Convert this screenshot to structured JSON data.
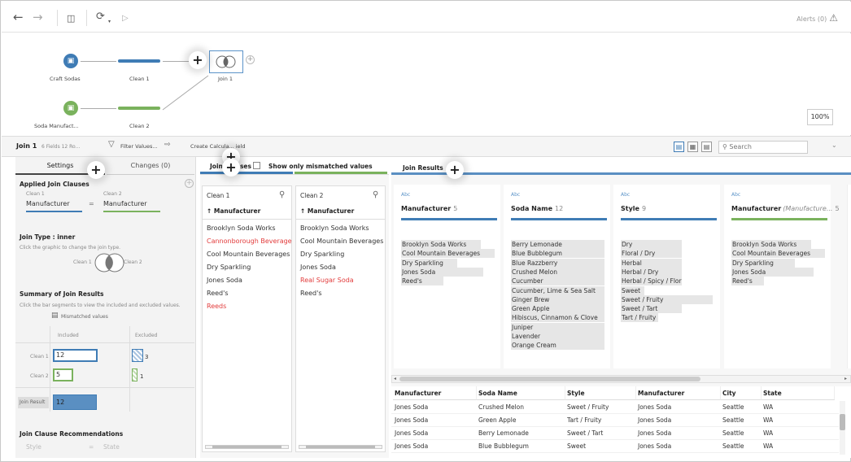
{
  "toolbar": {
    "alerts_label": "Alerts (0)"
  },
  "flow": {
    "nodes": [
      {
        "label": "Craft Sodas"
      },
      {
        "label": "Clean 1"
      },
      {
        "label": "Join 1"
      },
      {
        "label": "Soda Manufact..."
      },
      {
        "label": "Clean 2"
      }
    ],
    "zoom": "100%"
  },
  "step_bar": {
    "name": "Join 1",
    "meta": "6 Fields  12 Ro...",
    "filter_label": "Filter Values...",
    "calc_label": "Create Calcula...  ield",
    "search_placeholder": "Search"
  },
  "left_panel": {
    "tabs": [
      "Settings",
      "Changes (0)"
    ],
    "applied_title": "Applied Join Clauses",
    "clause": {
      "left_source": "Clean 1",
      "right_source": "Clean 2",
      "left_field": "Manufacturer",
      "operator": "=",
      "right_field": "Manufacturer"
    },
    "join_type_title": "Join Type : inner",
    "join_type_hint": "Click the graphic to change the join type.",
    "venn_left": "Clean 1",
    "venn_right": "Clean 2",
    "summary_title": "Summary of Join Results",
    "summary_hint": "Click the bar segments to view the included and excluded values.",
    "mismatch_legend": "Mismatched values",
    "col_included": "Included",
    "col_excluded": "Excluded",
    "rows": [
      {
        "label": "Clean 1",
        "included": "12",
        "excluded": "3"
      },
      {
        "label": "Clean 2",
        "included": "5",
        "excluded": "1"
      }
    ],
    "join_result_label": "Join Result",
    "join_result_value": "12",
    "recs_title": "Join Clause Recommendations",
    "rec": {
      "left": "Style",
      "op": "=",
      "right": "State"
    }
  },
  "mid_panel": {
    "title": "Join Clauses",
    "toggle_label": "Show only mismatched values",
    "columns": [
      {
        "source": "Clean 1",
        "field": "↑ Manufacturer",
        "values": [
          {
            "text": "Brooklyn Soda Works",
            "mismatch": false
          },
          {
            "text": "Cannonborough Beverage",
            "mismatch": true
          },
          {
            "text": "Cool Mountain Beverages",
            "mismatch": false
          },
          {
            "text": "Dry Sparkling",
            "mismatch": false
          },
          {
            "text": "Jones Soda",
            "mismatch": false
          },
          {
            "text": "Reed's",
            "mismatch": false
          },
          {
            "text": "Reeds",
            "mismatch": true
          }
        ]
      },
      {
        "source": "Clean 2",
        "field": "↑ Manufacturer",
        "values": [
          {
            "text": "Brooklyn Soda Works",
            "mismatch": false
          },
          {
            "text": "Cool Mountain Beverages",
            "mismatch": false
          },
          {
            "text": "Dry Sparkling",
            "mismatch": false
          },
          {
            "text": "Jones Soda",
            "mismatch": false
          },
          {
            "text": "Real Sugar Soda",
            "mismatch": true
          },
          {
            "text": "Reed's",
            "mismatch": false
          }
        ]
      }
    ]
  },
  "results": {
    "title": "Join Results",
    "cards": [
      {
        "type": "Abc",
        "name": "Manufacturer",
        "count": "5",
        "values": [
          "Brooklyn Soda Works",
          "Cool Mountain Beverages",
          "Dry Sparkling",
          "Jones Soda",
          "Reed's"
        ],
        "fills": [
          0.85,
          1.0,
          0.6,
          0.88,
          0.45
        ]
      },
      {
        "type": "Abc",
        "name": "Soda Name",
        "count": "12",
        "values": [
          "Berry Lemonade",
          "Blue Bubblegum",
          "Blue Razzberry",
          "Crushed Melon",
          "Cucumber",
          "Cucumber, Lime & Sea Salt",
          "Ginger Brew",
          "Green Apple",
          "Hibiscus, Cinnamon & Clove",
          "Juniper",
          "Lavender",
          "Orange Cream"
        ],
        "fills": [
          1,
          1,
          1,
          1,
          1,
          1,
          1,
          1,
          1,
          1,
          1,
          1
        ]
      },
      {
        "type": "Abc",
        "name": "Style",
        "count": "9",
        "values": [
          "Dry",
          "Floral / Dry",
          "Herbal",
          "Herbal / Dry",
          "Herbal / Spicy / Floral",
          "Sweet",
          "Sweet / Fruity",
          "Sweet / Tart",
          "Tart / Fruity"
        ],
        "fills": [
          0.65,
          0.65,
          0.65,
          0.65,
          0.65,
          0.25,
          0.98,
          0.65,
          0.4
        ]
      },
      {
        "type": "Abc",
        "name": "Manufacturer",
        "name_suffix": "(Manufacture...",
        "count": "5",
        "values": [
          "Brooklyn Soda Works",
          "Cool Mountain Beverages",
          "Dry Sparkling",
          "Jones Soda",
          "Reed's"
        ],
        "fills": [
          0.85,
          1.0,
          0.68,
          0.88,
          0.35
        ]
      }
    ],
    "table": {
      "headers": [
        "Manufacturer",
        "Soda Name",
        "Style",
        "Manufacturer",
        "City",
        "State"
      ],
      "rows": [
        [
          "Jones Soda",
          "Crushed Melon",
          "Sweet / Fruity",
          "Jones Soda",
          "Seattle",
          "WA"
        ],
        [
          "Jones Soda",
          "Green Apple",
          "Tart / Fruity",
          "Jones Soda",
          "Seattle",
          "WA"
        ],
        [
          "Jones Soda",
          "Berry Lemonade",
          "Sweet / Tart",
          "Jones Soda",
          "Seattle",
          "WA"
        ],
        [
          "Jones Soda",
          "Blue Bubblegum",
          "Sweet",
          "Jones Soda",
          "Seattle",
          "WA"
        ]
      ]
    }
  },
  "colors": {
    "clean1": "#3f7cb5",
    "clean2": "#7ab25d",
    "mismatch": "#e23c3c",
    "accent": "#5b93c8"
  }
}
